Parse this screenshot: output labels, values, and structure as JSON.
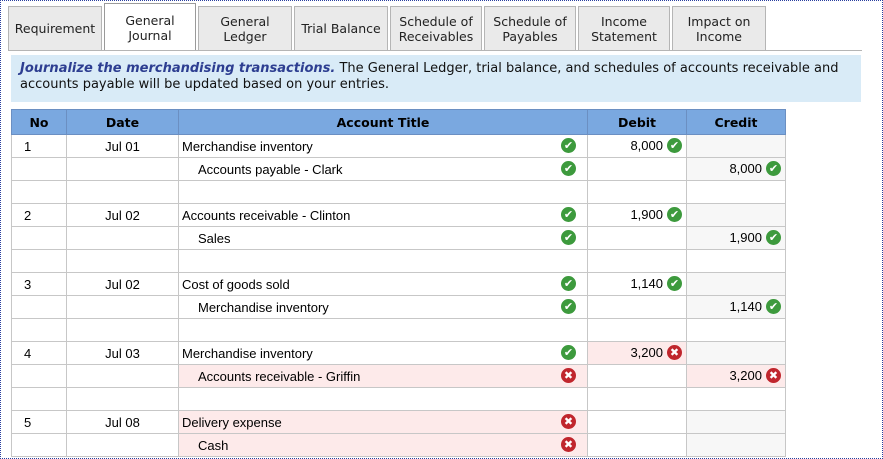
{
  "tabs": [
    {
      "line1": "Requirement",
      "line2": ""
    },
    {
      "line1": "General",
      "line2": "Journal"
    },
    {
      "line1": "General",
      "line2": "Ledger"
    },
    {
      "line1": "Trial Balance",
      "line2": ""
    },
    {
      "line1": "Schedule of",
      "line2": "Receivables"
    },
    {
      "line1": "Schedule of",
      "line2": "Payables"
    },
    {
      "line1": "Income",
      "line2": "Statement"
    },
    {
      "line1": "Impact on",
      "line2": "Income"
    }
  ],
  "active_tab": "General Journal",
  "instructions": {
    "lead": "Journalize the merchandising transactions.",
    "text": " The General Ledger, trial balance, and schedules of accounts receivable and accounts payable will be updated based on your entries."
  },
  "table": {
    "headers": {
      "no": "No",
      "date": "Date",
      "account": "Account Title",
      "debit": "Debit",
      "credit": "Credit"
    },
    "rows": [
      {
        "no": "1",
        "date": "Jul 01",
        "account": "Merchandise inventory",
        "acct_ok": true,
        "debit": "8,000",
        "debit_ok": true,
        "credit": ""
      },
      {
        "no": "",
        "date": "",
        "account": "Accounts payable - Clark",
        "acct_ok": true,
        "debit": "",
        "credit": "8,000",
        "credit_ok": true
      },
      {
        "no": "2",
        "date": "Jul 02",
        "account": "Accounts receivable - Clinton",
        "acct_ok": true,
        "debit": "1,900",
        "debit_ok": true,
        "credit": ""
      },
      {
        "no": "",
        "date": "",
        "account": "Sales",
        "acct_ok": true,
        "debit": "",
        "credit": "1,900",
        "credit_ok": true
      },
      {
        "no": "3",
        "date": "Jul 02",
        "account": "Cost of goods sold",
        "acct_ok": true,
        "debit": "1,140",
        "debit_ok": true,
        "credit": ""
      },
      {
        "no": "",
        "date": "",
        "account": "Merchandise inventory",
        "acct_ok": true,
        "debit": "",
        "credit": "1,140",
        "credit_ok": true
      },
      {
        "no": "4",
        "date": "Jul 03",
        "account": "Merchandise inventory",
        "acct_ok": true,
        "debit": "3,200",
        "debit_ok": false,
        "credit": ""
      },
      {
        "no": "",
        "date": "",
        "account": "Accounts receivable - Griffin",
        "acct_ok": false,
        "debit": "",
        "credit": "3,200",
        "credit_ok": false
      },
      {
        "no": "5",
        "date": "Jul 08",
        "account": "Delivery expense",
        "acct_ok": false,
        "debit": "",
        "credit": ""
      },
      {
        "no": "",
        "date": "",
        "account": "Cash",
        "acct_ok": false,
        "debit": "",
        "credit": ""
      }
    ]
  },
  "colors": {
    "tab_bg": "#eaeaea",
    "banner_bg": "#d9ebf7",
    "header_bg": "#7aa8e0",
    "ok": "#3d9a3d",
    "bad": "#c0262d",
    "error_row": "#fdeaea"
  },
  "icons": {
    "correct": "check-circle-icon",
    "incorrect": "x-circle-icon"
  }
}
